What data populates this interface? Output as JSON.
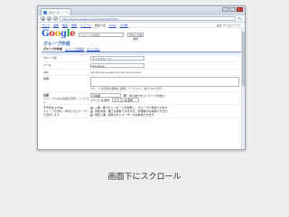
{
  "browser": {
    "tab_title": "グループ",
    "url": "https://groups.google.com/groups/create?hl=ja",
    "back": "◀",
    "forward": "▶",
    "reload": "↻",
    "menu": "🔧"
  },
  "gbar": {
    "items": [
      "ウェブ",
      "画像",
      "動画",
      "地図",
      "ニュース",
      "グループ",
      "Gmail",
      "その他"
    ],
    "current_index": 5,
    "right": "設定 ▼ | ログアウト"
  },
  "header": {
    "search_placeholder": "グループを検索",
    "search_button": "グループを検索"
  },
  "page": {
    "title": "グループ作成",
    "sub_bold": "グループの作成",
    "sub_link1": "メンバーを追加",
    "sub_link2": "キャンセル"
  },
  "form": {
    "name_label": "グループ名",
    "name_value": "テストグループ",
    "email_label": "メール",
    "email_value": "test-group",
    "url_label": "URL",
    "url_value": "http://groups.google.com/group/test-group",
    "desc_label": "説明",
    "desc_hint": "グループの目的を簡単に説明してください（最大 300 文字）",
    "lang_label": "言語",
    "lang_note": "グループの主な言語を選択してください",
    "lang_value": "日本語",
    "adult_label": "成人向けのコンテンツを含む",
    "category_label": "カテゴリを選択",
    "category_value": "カテゴリを選択",
    "access_label": "アクセス レベル",
    "access_note": "グループを閲覧・参加できるユーザーを選択します",
    "access_options": [
      "公開 - 誰でもメッセージを閲覧し、グループに参加できます",
      "告知専用 - 誰でも閲覧できますが、管理者のみ投稿できます",
      "限定公開 - 招待されたユーザーのみ参加できます"
    ],
    "access_selected": 0
  },
  "caption": "画面下にスクロール"
}
